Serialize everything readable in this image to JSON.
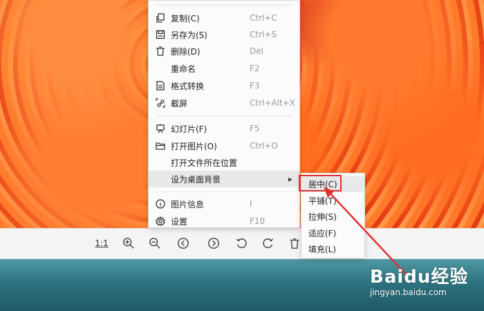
{
  "context_menu": {
    "items": [
      {
        "icon": "copy-icon",
        "label": "复制(C)",
        "shortcut": "Ctrl+C"
      },
      {
        "icon": "save-as-icon",
        "label": "另存为(S)",
        "shortcut": "Ctrl+S"
      },
      {
        "icon": "trash-icon",
        "label": "删除(D)",
        "shortcut": "Del"
      },
      {
        "icon": "",
        "label": "重命名",
        "shortcut": "F2"
      },
      {
        "icon": "document-convert-icon",
        "label": "格式转换",
        "shortcut": "F3"
      },
      {
        "icon": "screenshot-icon",
        "label": "截屏",
        "shortcut": "Ctrl+Alt+X"
      },
      {
        "icon": "slideshow-icon",
        "label": "幻灯片(F)",
        "shortcut": "F5"
      },
      {
        "icon": "folder-open-icon",
        "label": "打开图片(O)",
        "shortcut": "Ctrl+O"
      },
      {
        "icon": "",
        "label": "打开文件所在位置",
        "shortcut": ""
      },
      {
        "icon": "",
        "label": "设为桌面背景",
        "shortcut": "",
        "submenu": true
      },
      {
        "icon": "info-icon",
        "label": "图片信息",
        "shortcut": "I"
      },
      {
        "icon": "gear-icon",
        "label": "设置",
        "shortcut": "F10"
      }
    ]
  },
  "submenu": {
    "items": [
      "居中(C)",
      "平铺(T)",
      "拉伸(S)",
      "适应(F)",
      "填充(L)"
    ]
  },
  "toolbar": {
    "actual_size_label": "1:1"
  },
  "watermark": {
    "logo": "Baidu经验",
    "url": "jingyan.baidu.com"
  },
  "colors": {
    "highlight_box": "#e03131",
    "menu_bg": "#fbfbfb"
  }
}
